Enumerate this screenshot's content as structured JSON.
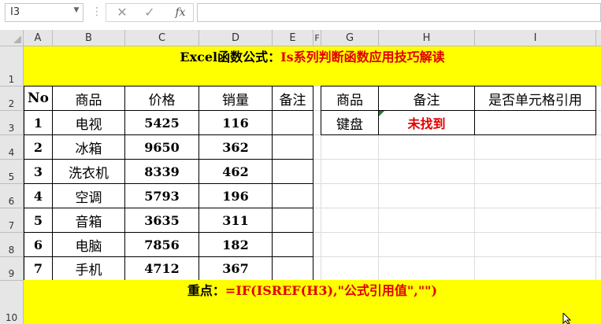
{
  "formula_bar": {
    "name_box": "I3",
    "formula": "",
    "icons": [
      "cancel-icon",
      "enter-icon",
      "fx-icon"
    ]
  },
  "columns": [
    "A",
    "B",
    "C",
    "D",
    "E",
    "F",
    "G",
    "H",
    "I"
  ],
  "rows": [
    "1",
    "2",
    "3",
    "4",
    "5",
    "6",
    "7",
    "8",
    "9",
    "10"
  ],
  "title": {
    "prefix": "Excel函数公式：",
    "highlight": "Is系列判断函数应用技巧解读"
  },
  "left_table": {
    "headers": [
      "No",
      "商品",
      "价格",
      "销量",
      "备注"
    ],
    "rows": [
      [
        "1",
        "电视",
        "5425",
        "116",
        ""
      ],
      [
        "2",
        "冰箱",
        "9650",
        "362",
        ""
      ],
      [
        "3",
        "洗衣机",
        "8339",
        "462",
        ""
      ],
      [
        "4",
        "空调",
        "5793",
        "196",
        ""
      ],
      [
        "5",
        "音箱",
        "3635",
        "311",
        ""
      ],
      [
        "6",
        "电脑",
        "7856",
        "182",
        ""
      ],
      [
        "7",
        "手机",
        "4712",
        "367",
        ""
      ]
    ]
  },
  "right_table": {
    "headers": [
      "商品",
      "备注",
      "是否单元格引用"
    ],
    "row": [
      "键盘",
      "未找到",
      ""
    ]
  },
  "bottom_note": {
    "prefix": "重点：",
    "formula": "=IF(ISREF(H3),\"公式引用值\",\"\")"
  },
  "colors": {
    "highlight_yellow": "#ffff00",
    "accent_red": "#e00000",
    "header_gray": "#e6e6e6"
  }
}
